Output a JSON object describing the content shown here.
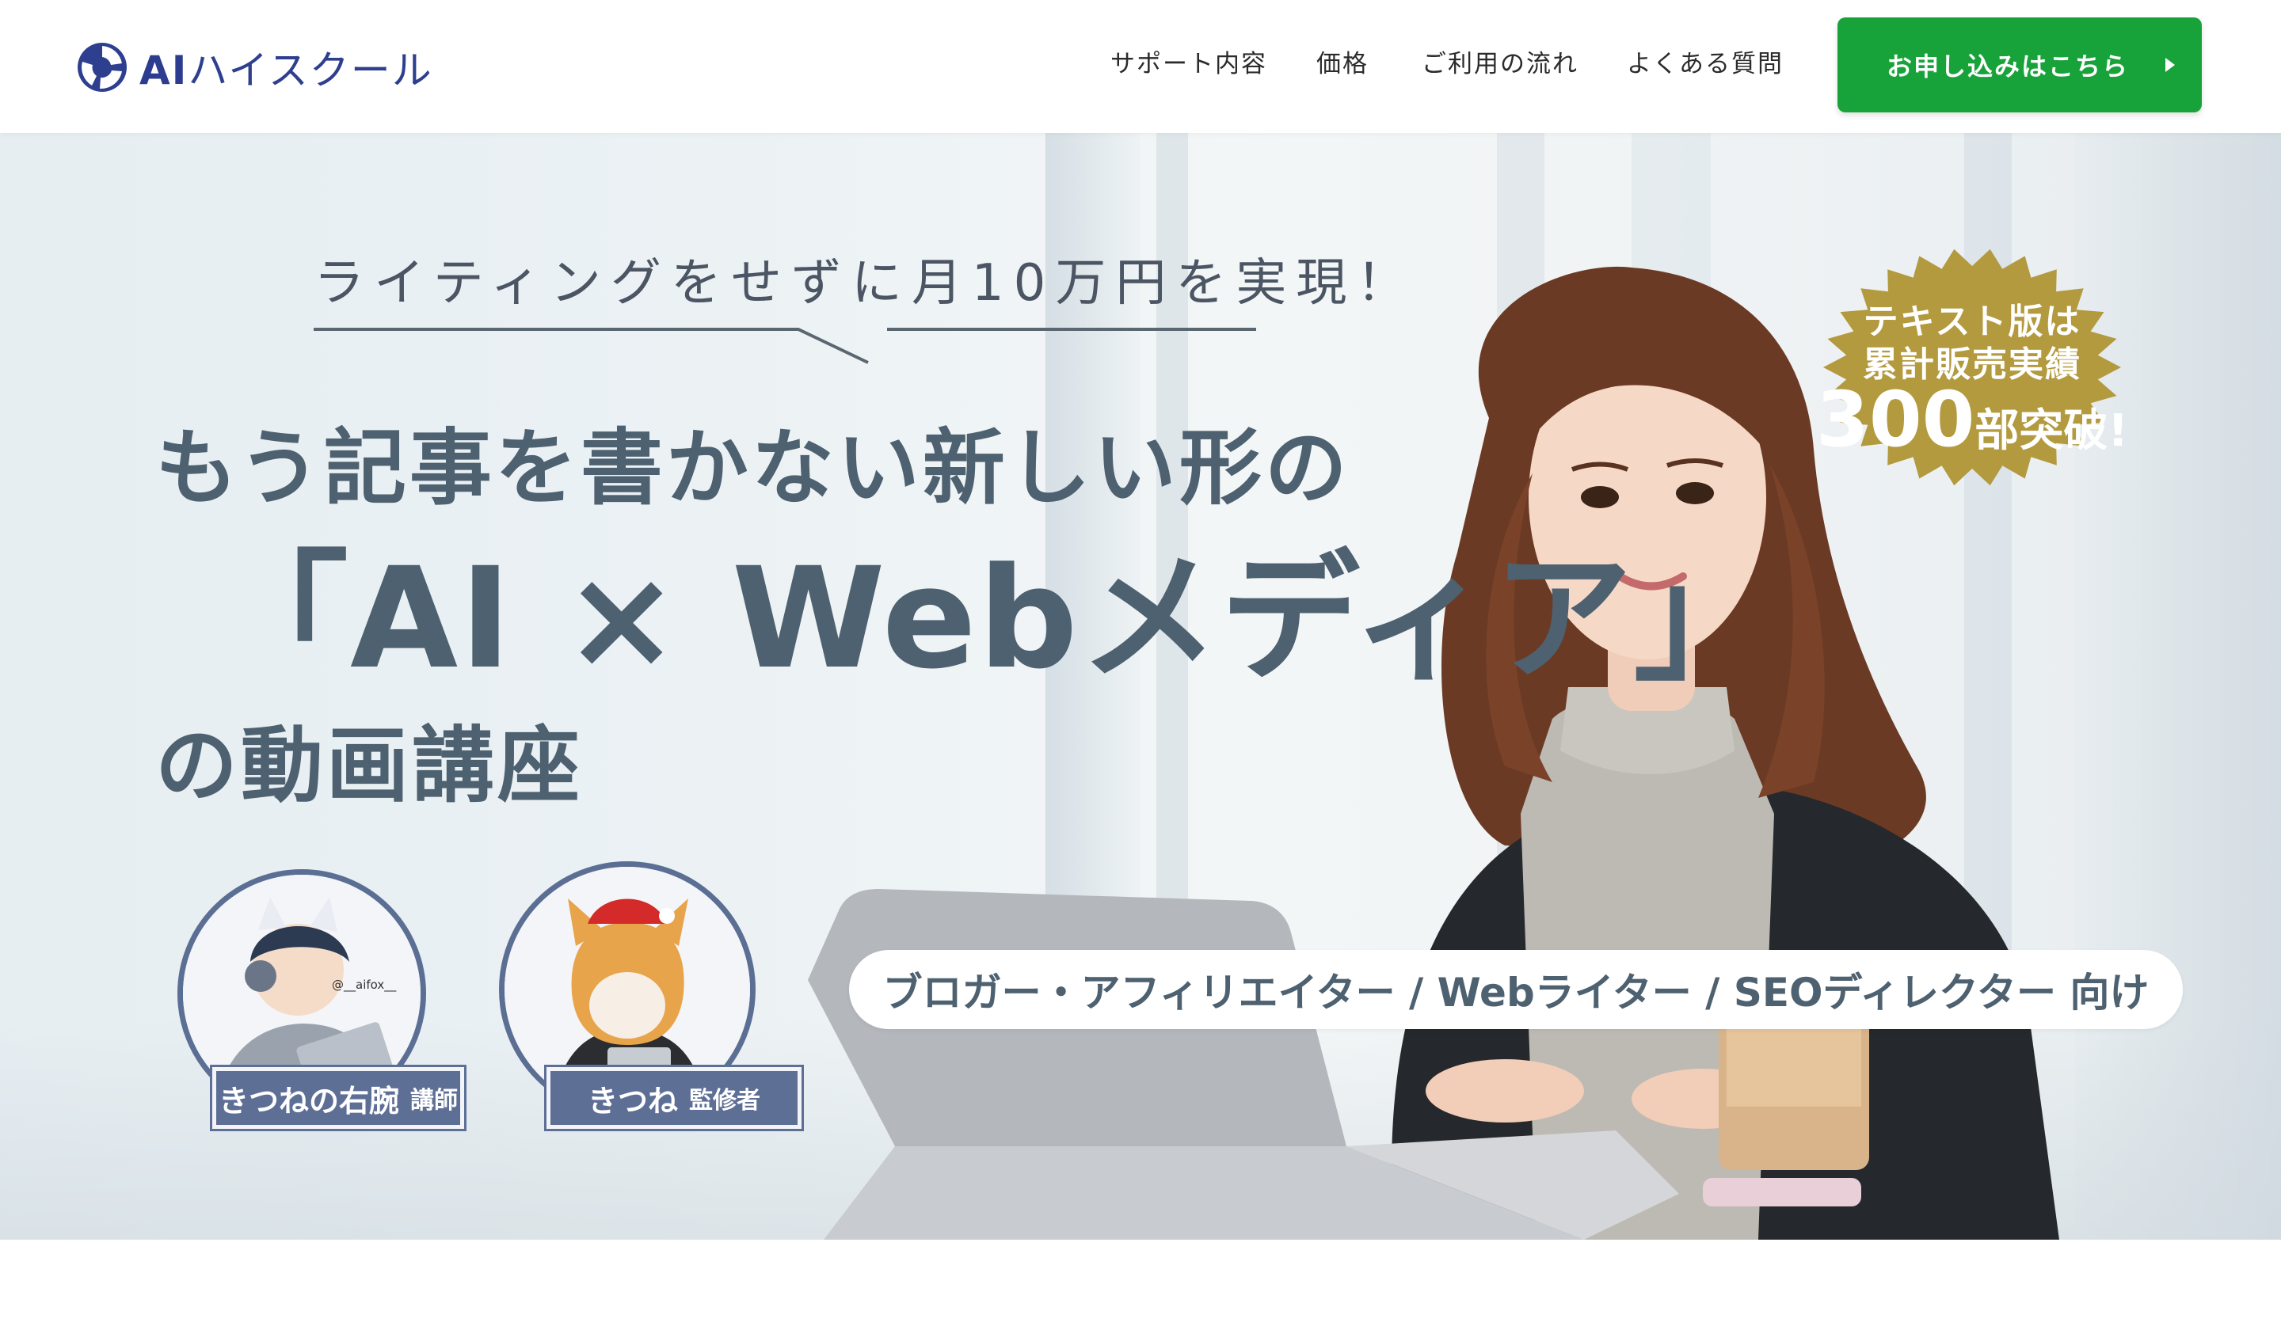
{
  "header": {
    "logo_ai": "AI",
    "logo_rest": "ハイスクール",
    "nav": [
      {
        "label": "サポート内容"
      },
      {
        "label": "価格"
      },
      {
        "label": "ご利用の流れ"
      },
      {
        "label": "よくある質問"
      }
    ],
    "cta_label": "お申し込みはこちら"
  },
  "hero": {
    "catchphrase": "ライティングをせずに月10万円を実現！",
    "headline_line1": "もう記事を書かない新しい形の",
    "headline_line2": "「AI × Webメディア」",
    "headline_line3": "の動画講座",
    "badge": {
      "line1": "テキスト版は",
      "line2": "累計販売実績",
      "number": "300",
      "suffix": "部突破!"
    },
    "audience": "ブロガー・アフィリエイター / Webライター / SEOディレクター 向け",
    "instructors": [
      {
        "name": "きつねの右腕",
        "role": "講師",
        "handle": "@__aifox__"
      },
      {
        "name": "きつね",
        "role": "監修者"
      }
    ]
  },
  "colors": {
    "brand_navy": "#2e3f8f",
    "cta_green": "#18a33a",
    "badge_gold": "#b39a3e",
    "headline_slate": "#4e6170",
    "nameplate_blue": "#5e6f96"
  }
}
